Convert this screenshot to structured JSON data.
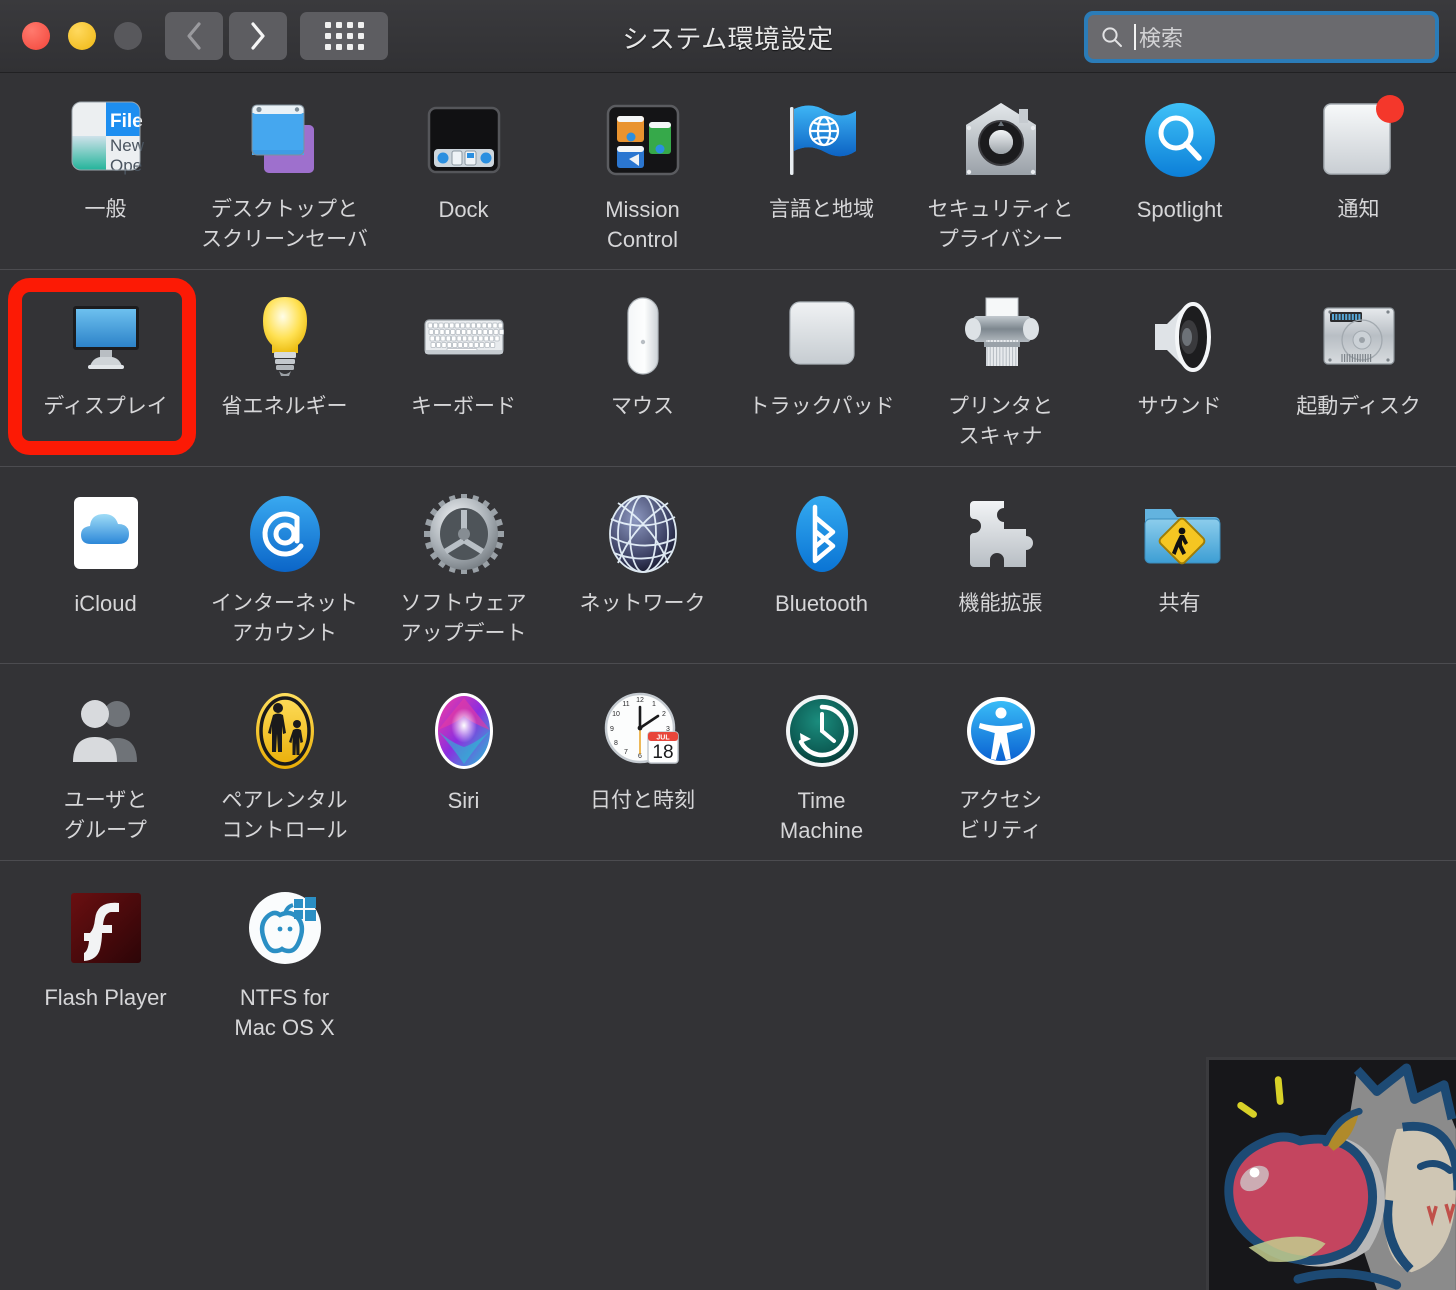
{
  "window": {
    "title": "システム環境設定",
    "traffic_lights": [
      {
        "name": "close",
        "color": "#f3453a"
      },
      {
        "name": "minimize",
        "color": "#efb713"
      },
      {
        "name": "zoom",
        "color": "#58585c"
      }
    ],
    "nav": {
      "back_label": "戻る",
      "forward_label": "進む",
      "grid_label": "すべてを表示"
    },
    "search": {
      "placeholder": "検索",
      "value": "",
      "focused": true,
      "focus_ring_color": "#2b7cb8"
    }
  },
  "theme": {
    "background": "#333336",
    "titlebar": "#3a3a3d",
    "separator": "#4c4c50",
    "label_color": "#d6d6d8",
    "highlight_color": "#fc1a05"
  },
  "annotation": {
    "highlight_target": "ディスプレイ",
    "shape": "rounded-rectangle",
    "color": "#fc1a05"
  },
  "rows": [
    {
      "items": [
        {
          "icon": "general-icon",
          "label": "一般",
          "lang": "ja"
        },
        {
          "icon": "desktop-screensaver-icon",
          "label": "デスクトップと\nスクリーンセーバ",
          "lang": "ja"
        },
        {
          "icon": "dock-icon",
          "label": "Dock",
          "lang": "en"
        },
        {
          "icon": "mission-control-icon",
          "label": "Mission\nControl",
          "lang": "en"
        },
        {
          "icon": "language-region-icon",
          "label": "言語と地域",
          "lang": "ja"
        },
        {
          "icon": "security-privacy-icon",
          "label": "セキュリティと\nプライバシー",
          "lang": "ja"
        },
        {
          "icon": "spotlight-icon",
          "label": "Spotlight",
          "lang": "en"
        },
        {
          "icon": "notifications-icon",
          "label": "通知",
          "lang": "ja",
          "badge": true
        }
      ]
    },
    {
      "items": [
        {
          "icon": "displays-icon",
          "label": "ディスプレイ",
          "lang": "ja",
          "highlighted": true
        },
        {
          "icon": "energy-saver-icon",
          "label": "省エネルギー",
          "lang": "ja"
        },
        {
          "icon": "keyboard-icon",
          "label": "キーボード",
          "lang": "ja"
        },
        {
          "icon": "mouse-icon",
          "label": "マウス",
          "lang": "ja"
        },
        {
          "icon": "trackpad-icon",
          "label": "トラックパッド",
          "lang": "ja"
        },
        {
          "icon": "printers-scanners-icon",
          "label": "プリンタと\nスキャナ",
          "lang": "ja"
        },
        {
          "icon": "sound-icon",
          "label": "サウンド",
          "lang": "ja"
        },
        {
          "icon": "startup-disk-icon",
          "label": "起動ディスク",
          "lang": "ja"
        }
      ]
    },
    {
      "items": [
        {
          "icon": "icloud-icon",
          "label": "iCloud",
          "lang": "en"
        },
        {
          "icon": "internet-accounts-icon",
          "label": "インターネット\nアカウント",
          "lang": "ja"
        },
        {
          "icon": "software-update-icon",
          "label": "ソフトウェア\nアップデート",
          "lang": "ja"
        },
        {
          "icon": "network-icon",
          "label": "ネットワーク",
          "lang": "ja"
        },
        {
          "icon": "bluetooth-icon",
          "label": "Bluetooth",
          "lang": "en"
        },
        {
          "icon": "extensions-icon",
          "label": "機能拡張",
          "lang": "ja"
        },
        {
          "icon": "sharing-icon",
          "label": "共有",
          "lang": "ja"
        }
      ]
    },
    {
      "items": [
        {
          "icon": "users-groups-icon",
          "label": "ユーザと\nグループ",
          "lang": "ja"
        },
        {
          "icon": "parental-controls-icon",
          "label": "ペアレンタル\nコントロール",
          "lang": "ja"
        },
        {
          "icon": "siri-icon",
          "label": "Siri",
          "lang": "en"
        },
        {
          "icon": "date-time-icon",
          "label": "日付と時刻",
          "lang": "ja",
          "month": "JUL",
          "day": "18"
        },
        {
          "icon": "time-machine-icon",
          "label": "Time\nMachine",
          "lang": "en"
        },
        {
          "icon": "accessibility-icon",
          "label": "アクセシ\nビリティ",
          "lang": "ja"
        }
      ]
    },
    {
      "items": [
        {
          "icon": "flash-player-icon",
          "label": "Flash Player",
          "lang": "en"
        },
        {
          "icon": "ntfs-mac-icon",
          "label": "NTFS for\nMac OS X",
          "lang": "en"
        }
      ]
    }
  ]
}
